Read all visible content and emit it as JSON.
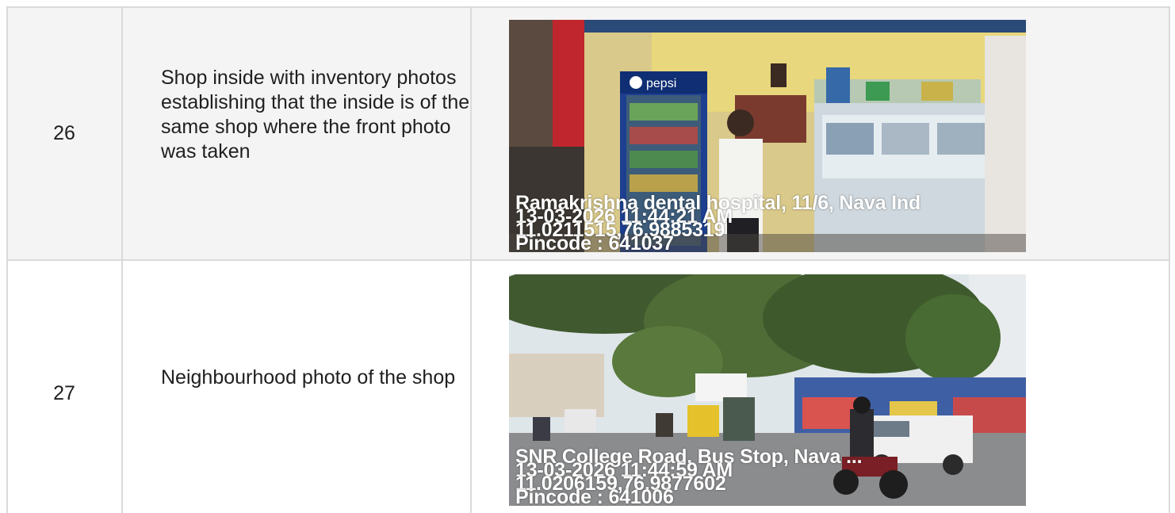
{
  "rows": [
    {
      "number": "26",
      "description": "Shop inside with inventory photos establishing that the inside is of the same shop where the front photo was taken",
      "photo": {
        "subject": "shop interior with Pepsi cooler, shopkeeper and display counter",
        "brand_text": "pepsi",
        "stamp": {
          "address": "Ramakrishna dental hospital, 11/6, Nava Ind",
          "datetime": "13-03-2026 11:44:21 AM",
          "coordinates": "11.0211515,76.9885319",
          "pincode": "Pincode : 641037"
        }
      }
    },
    {
      "number": "27",
      "description": "Neighbourhood photo of the shop",
      "photo": {
        "subject": "street view with trees, buses, autorickshaws and motorcycles",
        "stamp": {
          "address": "SNR College Road, Bus Stop, Nava ...",
          "datetime": "13-03-2026 11:44:59 AM",
          "coordinates": "11.0206159,76.9877602",
          "pincode": "Pincode : 641006"
        }
      }
    }
  ],
  "colors": {
    "row_alt_bg": "#f4f4f4",
    "border": "#dadada",
    "text": "#1f1f1f"
  }
}
